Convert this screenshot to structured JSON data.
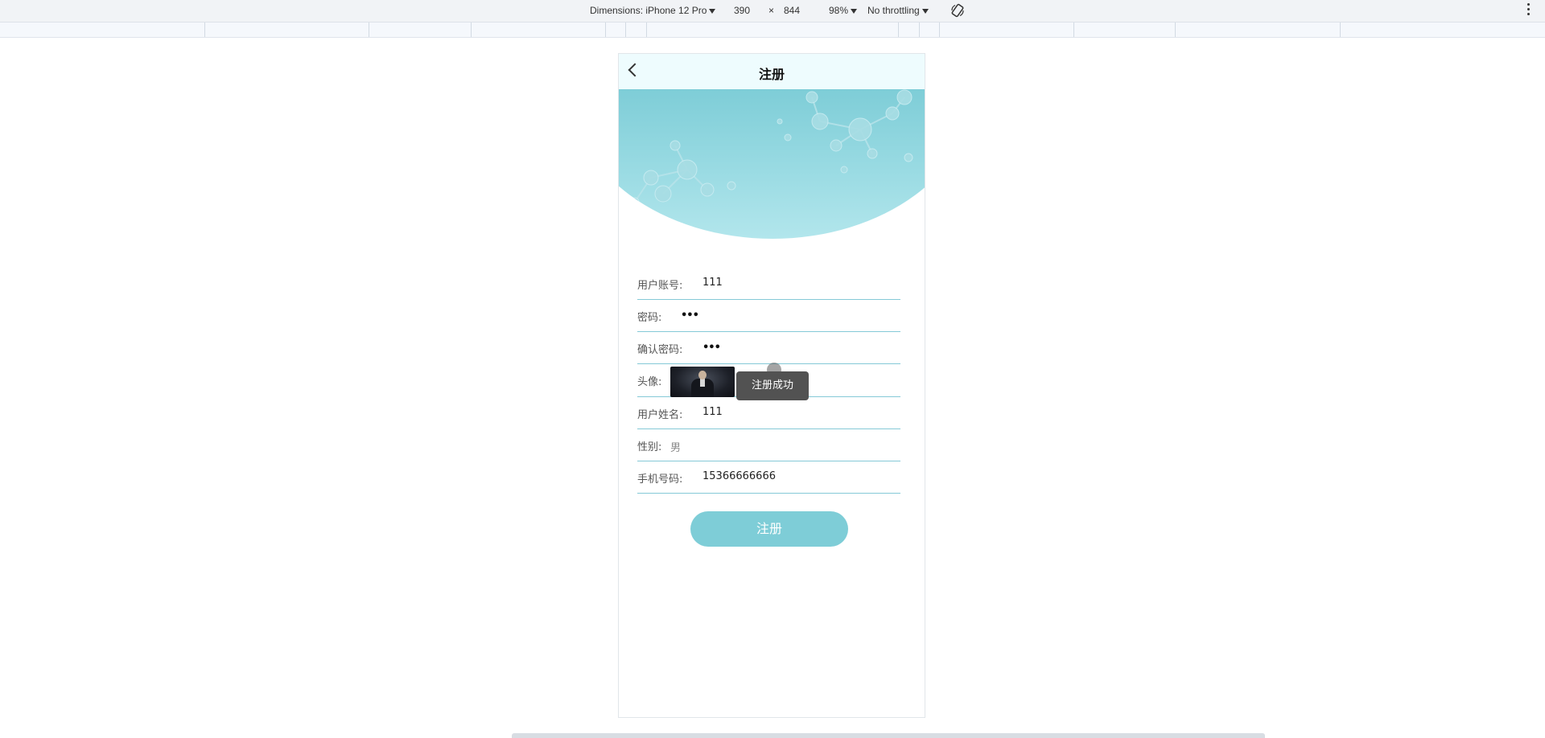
{
  "devtools": {
    "dimensions": "Dimensions: iPhone 12 Pro",
    "width": "390",
    "times": "×",
    "height": "844",
    "zoom": "98%",
    "throttling": "No throttling"
  },
  "page": {
    "title": "注册",
    "form": {
      "account": {
        "label": "用户账号:",
        "value": "111"
      },
      "password": {
        "label": "密码:",
        "value": "•••"
      },
      "confirm": {
        "label": "确认密码:",
        "value": "•••"
      },
      "avatar": {
        "label": "头像:"
      },
      "name": {
        "label": "用户姓名:",
        "value": "111"
      },
      "gender": {
        "label": "性别:",
        "value": "男"
      },
      "phone": {
        "label": "手机号码:",
        "value": "15366666666"
      }
    },
    "submit": "注册",
    "toast": "注册成功"
  },
  "colors": {
    "accent": "#7ecdd7",
    "line": "#85c9d7",
    "nav_bg": "#eefcfe"
  }
}
